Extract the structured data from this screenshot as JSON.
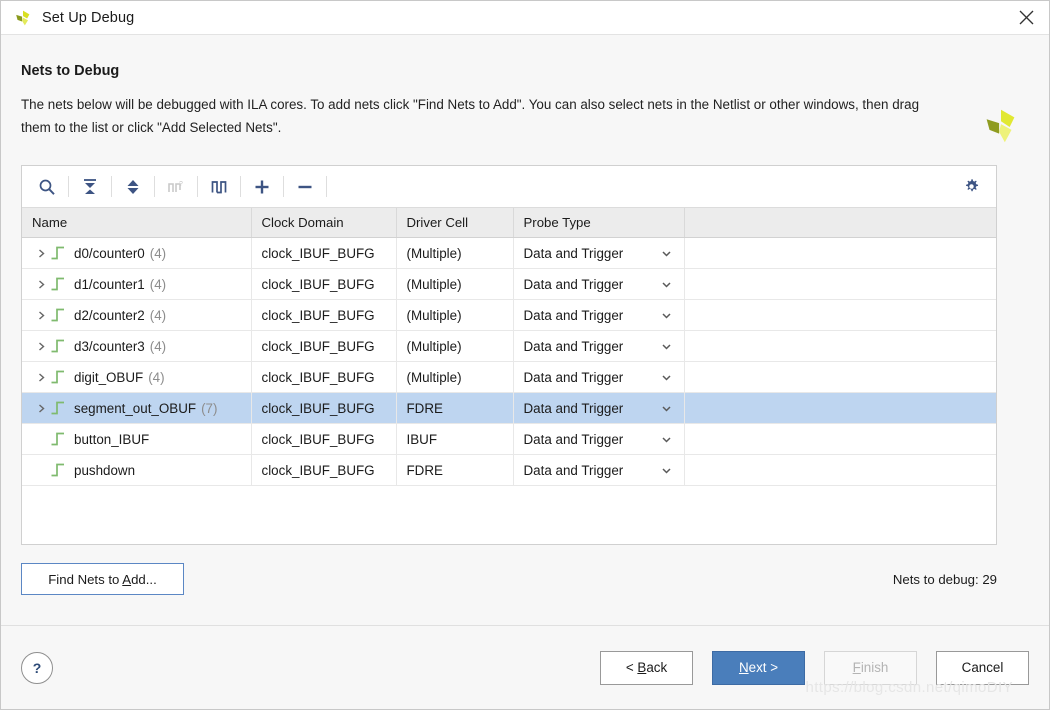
{
  "window": {
    "title": "Set Up Debug",
    "logo_icon": "vivado-logo-icon",
    "close_icon": "close-icon"
  },
  "page": {
    "title": "Nets to Debug",
    "description": "The nets below will be debugged with ILA cores. To add nets click \"Find Nets to Add\". You can also select nets in the Netlist or other windows, then drag them to the list or click \"Add Selected Nets\".",
    "corner_logo_icon": "xilinx-logo-icon"
  },
  "toolbar": {
    "buttons": [
      {
        "name": "search-icon",
        "label": "Search",
        "enabled": true
      },
      {
        "name": "collapse-all-icon",
        "label": "Collapse All",
        "enabled": true
      },
      {
        "name": "expand-all-icon",
        "label": "Expand All",
        "enabled": true
      },
      {
        "name": "unselected-waveform-icon",
        "label": "Select Net",
        "enabled": false
      },
      {
        "name": "waveform-icon",
        "label": "Show Waveform",
        "enabled": true
      },
      {
        "name": "plus-icon",
        "label": "Add Nets",
        "enabled": true
      },
      {
        "name": "minus-icon",
        "label": "Remove Nets",
        "enabled": true
      }
    ],
    "settings_icon": "gear-icon"
  },
  "table": {
    "columns": [
      "Name",
      "Clock Domain",
      "Driver Cell",
      "Probe Type",
      ""
    ],
    "rows": [
      {
        "name": "d0/counter0",
        "count": "(4)",
        "expandable": true,
        "selected": false,
        "clock_domain": "clock_IBUF_BUFG",
        "driver_cell": "(Multiple)",
        "probe_type": "Data and Trigger"
      },
      {
        "name": "d1/counter1",
        "count": "(4)",
        "expandable": true,
        "selected": false,
        "clock_domain": "clock_IBUF_BUFG",
        "driver_cell": "(Multiple)",
        "probe_type": "Data and Trigger"
      },
      {
        "name": "d2/counter2",
        "count": "(4)",
        "expandable": true,
        "selected": false,
        "clock_domain": "clock_IBUF_BUFG",
        "driver_cell": "(Multiple)",
        "probe_type": "Data and Trigger"
      },
      {
        "name": "d3/counter3",
        "count": "(4)",
        "expandable": true,
        "selected": false,
        "clock_domain": "clock_IBUF_BUFG",
        "driver_cell": "(Multiple)",
        "probe_type": "Data and Trigger"
      },
      {
        "name": "digit_OBUF",
        "count": "(4)",
        "expandable": true,
        "selected": false,
        "clock_domain": "clock_IBUF_BUFG",
        "driver_cell": "(Multiple)",
        "probe_type": "Data and Trigger"
      },
      {
        "name": "segment_out_OBUF",
        "count": "(7)",
        "expandable": true,
        "selected": true,
        "clock_domain": "clock_IBUF_BUFG",
        "driver_cell": "FDRE",
        "probe_type": "Data and Trigger"
      },
      {
        "name": "button_IBUF",
        "count": "",
        "expandable": false,
        "selected": false,
        "clock_domain": "clock_IBUF_BUFG",
        "driver_cell": "IBUF",
        "probe_type": "Data and Trigger"
      },
      {
        "name": "pushdown",
        "count": "",
        "expandable": false,
        "selected": false,
        "clock_domain": "clock_IBUF_BUFG",
        "driver_cell": "FDRE",
        "probe_type": "Data and Trigger"
      }
    ]
  },
  "actions": {
    "find_nets_pre": "Find Nets to ",
    "find_nets_accel": "A",
    "find_nets_post": "dd...",
    "nets_to_debug": "Nets to debug: 29"
  },
  "footer": {
    "help_label": "?",
    "back_pre": "< ",
    "back_accel": "B",
    "back_post": "ack",
    "next_pre": "",
    "next_accel": "N",
    "next_post": "ext >",
    "finish_pre": "",
    "finish_accel": "F",
    "finish_post": "inish",
    "cancel_label": "Cancel"
  },
  "watermark": "https://blog.csdn.net/qimoDIY",
  "colors": {
    "selection": "#bed5f0",
    "primary_button": "#4a7ebb",
    "icon_blue": "#3d5483",
    "net_icon_green": "#7fba6e",
    "header_bg": "#ececec"
  }
}
